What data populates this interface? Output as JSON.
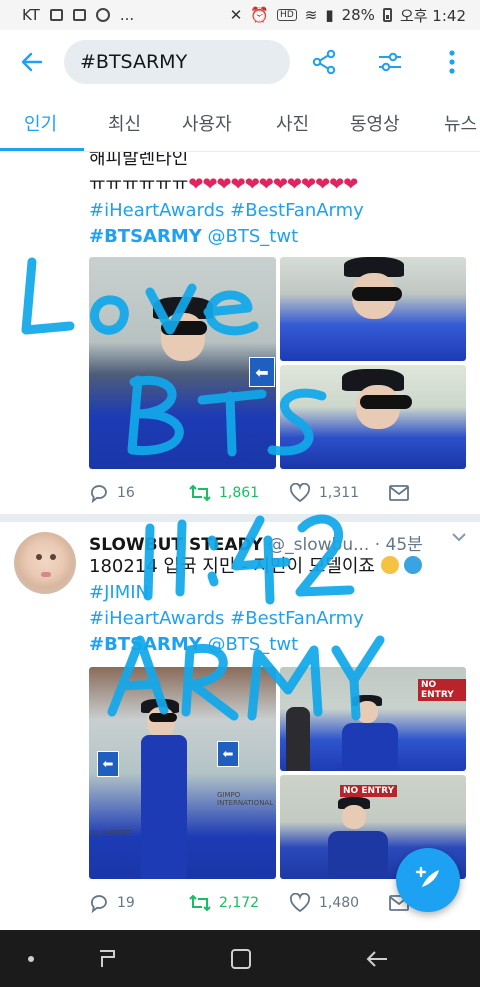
{
  "status_bar": {
    "carrier": "KT",
    "more": "...",
    "battery": "28%",
    "time": "오후 1:42"
  },
  "search": {
    "query": "#BTSARMY"
  },
  "tabs": [
    {
      "label": "인기"
    },
    {
      "label": "최신"
    },
    {
      "label": "사용자"
    },
    {
      "label": "사진"
    },
    {
      "label": "동영상"
    },
    {
      "label": "뉴스"
    }
  ],
  "tweet1": {
    "line1": "해피발렌타인",
    "line2": "ㅠㅠㅠㅠㅠㅠ",
    "hearts": "❤❤❤❤❤❤❤❤❤❤❤❤",
    "tags1a": "#iHeartAwards",
    "tags1b": "#BestFanArmy",
    "tag_bold": "#BTSARMY",
    "mention": "@BTS_twt",
    "replies": "16",
    "retweets": "1,861",
    "likes": "1,311"
  },
  "tweet2": {
    "name": "SLOWBUT STEADY",
    "handle": "@_slowbu...",
    "time": "· 45분",
    "text": "180214 입국 지민 - 지민이 모델이죠",
    "tag_jimin": "#JIMIN",
    "tags1a": "#iHeartAwards",
    "tags1b": "#BestFanArmy",
    "tag_bold": "#BTSARMY",
    "mention": "@BTS_twt",
    "replies": "19",
    "retweets": "2,172",
    "likes": "1,480"
  },
  "photo_signs": {
    "no_entry_1": "NO ENTRY",
    "no_entry_2": "NO ENTRY",
    "gimpo": "GIMPO INTERNATIONAL",
    "airport": "AL AIRPORT"
  },
  "handwriting": {
    "line1": "Love",
    "line2": "BTS",
    "line3": "11:42",
    "line4": "ARMY"
  },
  "colors": {
    "accent": "#1da1f2",
    "retweet": "#17bf63",
    "heart": "#e0245e",
    "marker": "#12a8ea"
  }
}
